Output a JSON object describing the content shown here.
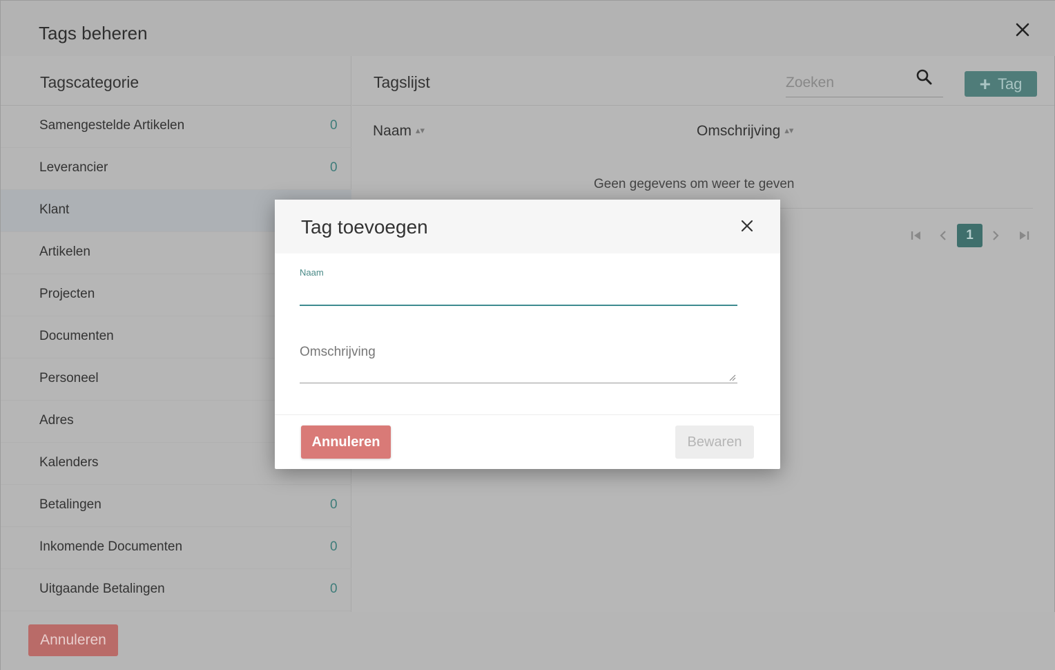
{
  "outer": {
    "title": "Tags beheren",
    "cancel_label": "Annuleren"
  },
  "categories": {
    "header": "Tagscategorie",
    "items": [
      {
        "label": "Samengestelde Artikelen",
        "count": "0"
      },
      {
        "label": "Leverancier",
        "count": "0"
      },
      {
        "label": "Klant",
        "count": ""
      },
      {
        "label": "Artikelen",
        "count": ""
      },
      {
        "label": "Projecten",
        "count": ""
      },
      {
        "label": "Documenten",
        "count": ""
      },
      {
        "label": "Personeel",
        "count": ""
      },
      {
        "label": "Adres",
        "count": ""
      },
      {
        "label": "Kalenders",
        "count": ""
      },
      {
        "label": "Betalingen",
        "count": "0"
      },
      {
        "label": "Inkomende Documenten",
        "count": "0"
      },
      {
        "label": "Uitgaande Betalingen",
        "count": "0"
      }
    ],
    "selected": "Klant"
  },
  "tags_list": {
    "title": "Tagslijst",
    "search_placeholder": "Zoeken",
    "add_button_label": "Tag",
    "columns": [
      "Naam",
      "Omschrijving"
    ],
    "empty_message": "Geen gegevens om weer te geven",
    "current_page": "1"
  },
  "modal": {
    "title": "Tag toevoegen",
    "naam_label": "Naam",
    "naam_value": "",
    "omschrijving_placeholder": "Omschrijving",
    "cancel_label": "Annuleren",
    "save_label": "Bewaren"
  },
  "colors": {
    "accent": "#3d8a8f",
    "danger": "#d97a77",
    "overlay": "#b7b7b7"
  }
}
